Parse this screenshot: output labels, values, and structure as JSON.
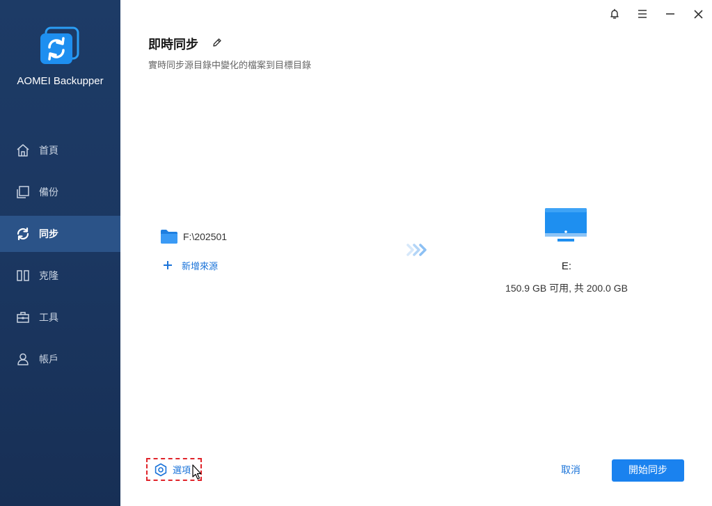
{
  "app": {
    "name": "AOMEI Backupper"
  },
  "sidebar": {
    "items": [
      {
        "label": "首頁",
        "icon": "home-icon"
      },
      {
        "label": "備份",
        "icon": "backup-icon"
      },
      {
        "label": "同步",
        "icon": "sync-icon",
        "active": true
      },
      {
        "label": "克隆",
        "icon": "clone-icon"
      },
      {
        "label": "工具",
        "icon": "toolbox-icon"
      },
      {
        "label": "帳戶",
        "icon": "user-icon"
      }
    ]
  },
  "header": {
    "title": "即時同步",
    "subtitle": "實時同步源目錄中變化的檔案到目標目錄"
  },
  "source": {
    "path": "F:\\202501",
    "add_label": "新增來源"
  },
  "destination": {
    "name": "E:",
    "space": "150.9 GB 可用, 共 200.0 GB"
  },
  "footer": {
    "options_label": "選項",
    "cancel_label": "取消",
    "start_label": "開始同步"
  },
  "colors": {
    "sidebar_bg": "#1b3761",
    "sidebar_active": "#2b5388",
    "accent": "#1a82ef",
    "link": "#1a73d9",
    "highlight_border": "#e0242a"
  }
}
